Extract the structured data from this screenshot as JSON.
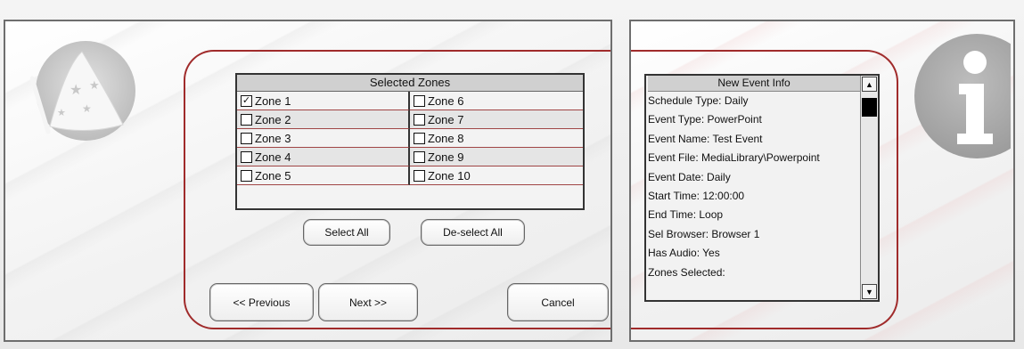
{
  "zones": {
    "title": "Selected Zones",
    "items": [
      {
        "label": "Zone 1",
        "checked": true
      },
      {
        "label": "Zone 2",
        "checked": false
      },
      {
        "label": "Zone 3",
        "checked": false
      },
      {
        "label": "Zone 4",
        "checked": false
      },
      {
        "label": "Zone 5",
        "checked": false
      },
      {
        "label": "Zone 6",
        "checked": false
      },
      {
        "label": "Zone 7",
        "checked": false
      },
      {
        "label": "Zone 8",
        "checked": false
      },
      {
        "label": "Zone 9",
        "checked": false
      },
      {
        "label": "Zone 10",
        "checked": false
      }
    ]
  },
  "buttons": {
    "select_all": "Select All",
    "deselect_all": "De-select All",
    "previous": "<< Previous",
    "next": "Next >>",
    "cancel": "Cancel"
  },
  "info": {
    "title": "New Event Info",
    "lines": [
      "Schedule Type: Daily",
      "Event Type: PowerPoint",
      "Event Name: Test Event",
      "Event File: MediaLibrary\\Powerpoint",
      "Event Date: Daily",
      "Start Time: 12:00:00",
      "End Time: Loop",
      "Sel Browser: Browser 1",
      "Has Audio: Yes",
      "Zones Selected:"
    ]
  },
  "icons": {
    "wizard": "wizard-hat-icon",
    "info": "info-icon",
    "scroll_up": "▲",
    "scroll_down": "▼",
    "check": "✓"
  },
  "colors": {
    "accent_frame": "#a02b2b",
    "header_gray": "#d0d0d0"
  }
}
